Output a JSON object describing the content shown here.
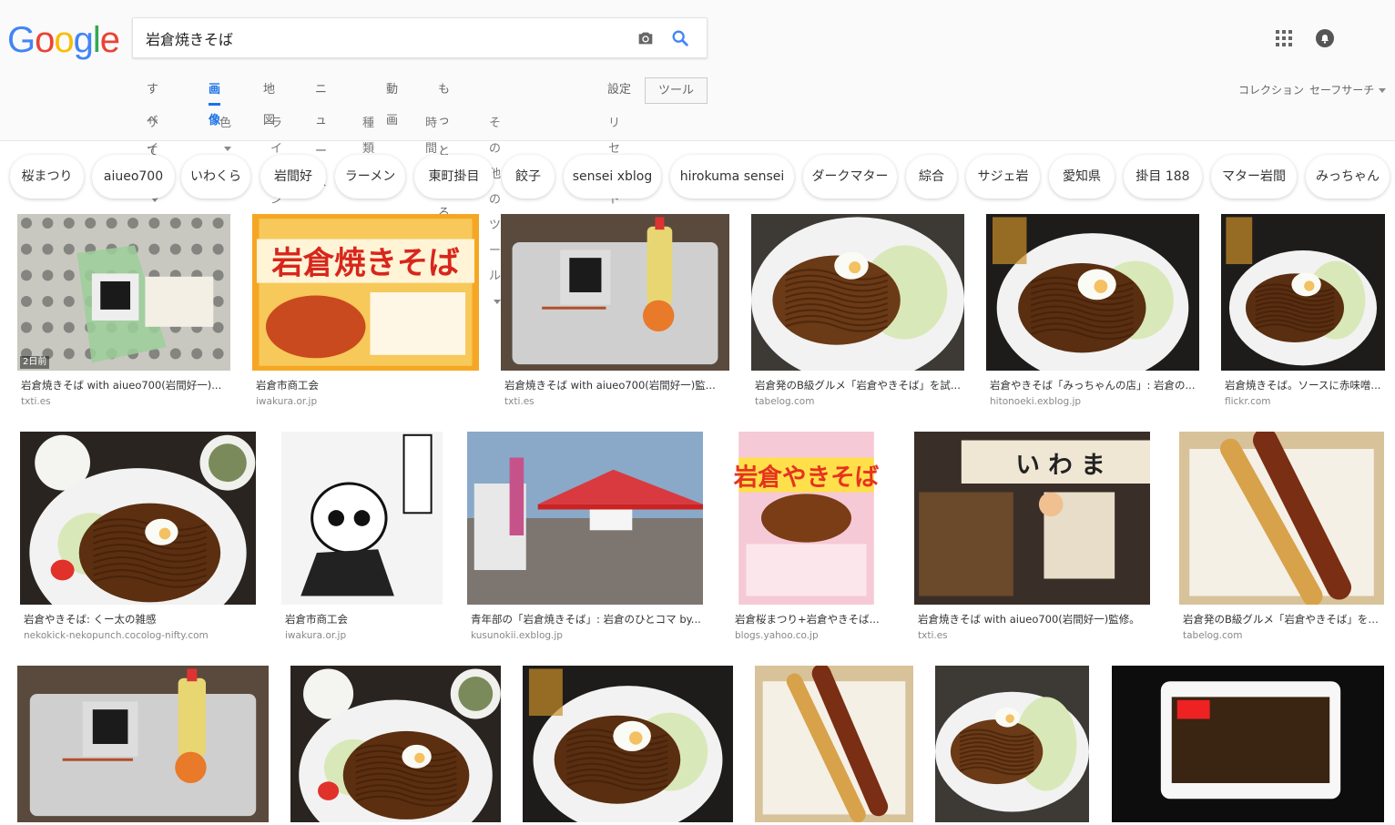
{
  "header": {
    "logo_letters": [
      "G",
      "o",
      "o",
      "g",
      "l",
      "e"
    ],
    "logo_colors": [
      "#4285f4",
      "#ea4335",
      "#fbbc05",
      "#4285f4",
      "#34a853",
      "#ea4335"
    ],
    "search_value": "岩倉焼きそば",
    "apps_icon": "apps-grid-icon",
    "notification_icon": "notifications-icon"
  },
  "tabs": [
    {
      "label": "すべて",
      "active": false
    },
    {
      "label": "画像",
      "active": true
    },
    {
      "label": "地図",
      "active": false
    },
    {
      "label": "ニュース",
      "active": false
    },
    {
      "label": "動画",
      "active": false
    },
    {
      "label": "もっと見る",
      "active": false
    }
  ],
  "settings_label": "設定",
  "tools_label": "ツール",
  "collection_label": "コレクション",
  "safesearch_label": "セーフサーチ",
  "filters": [
    {
      "label": "サイズ",
      "dropdown": true
    },
    {
      "label": "色",
      "dropdown": true
    },
    {
      "label": "ライセンス",
      "dropdown": true
    },
    {
      "label": "種類",
      "dropdown": true
    },
    {
      "label": "時間",
      "dropdown": true
    },
    {
      "label": "その他のツール",
      "dropdown": true
    },
    {
      "label": "リセット",
      "dropdown": false
    }
  ],
  "chips": [
    "桜まつり",
    "aiueo700",
    "いわくら",
    "岩間好",
    "ラーメン",
    "東町掛目",
    "餃子",
    "sensei xblog",
    "hirokuma sensei",
    "ダークマター",
    "綜合",
    "サジェ岩",
    "愛知県",
    "掛目 188",
    "マター岩間",
    "みっちゃん"
  ],
  "results": [
    {
      "caption": "岩倉焼きそば with aiueo700(岩間好一)...",
      "domain": "txti.es",
      "badge": "2日前",
      "scene": "tray"
    },
    {
      "caption": "岩倉市商工会",
      "domain": "iwakura.or.jp",
      "badge": "",
      "scene": "poster"
    },
    {
      "caption": "岩倉焼きそば with aiueo700(岩間好一)監...",
      "domain": "txti.es",
      "badge": "",
      "scene": "tray2"
    },
    {
      "caption": "岩倉発のB級グルメ「岩倉やきそば」を試...",
      "domain": "tabelog.com",
      "badge": "",
      "scene": "noodles"
    },
    {
      "caption": "岩倉やきそば「みっちゃんの店」: 岩倉の...",
      "domain": "hitonoeki.exblog.jp",
      "badge": "",
      "scene": "noodles-dark"
    },
    {
      "caption": "岩倉焼きそば。ソースに赤味噌...",
      "domain": "flickr.com",
      "badge": "",
      "scene": "noodles-dark"
    },
    {
      "caption": "岩倉やきそば: くー太の雑感",
      "domain": "nekokick-nekopunch.cocolog-nifty.com",
      "badge": "",
      "scene": "set-meal"
    },
    {
      "caption": "岩倉市商工会",
      "domain": "iwakura.or.jp",
      "badge": "",
      "scene": "mascot"
    },
    {
      "caption": "青年部の「岩倉焼きそば」: 岩倉のひとコマ by...",
      "domain": "kusunokii.exblog.jp",
      "badge": "",
      "scene": "tent"
    },
    {
      "caption": "岩倉桜まつり+岩倉やきそば...",
      "domain": "blogs.yahoo.co.jp",
      "badge": "",
      "scene": "flyer"
    },
    {
      "caption": "岩倉焼きそば with aiueo700(岩間好一)監修。",
      "domain": "txti.es",
      "badge": "",
      "scene": "shop"
    },
    {
      "caption": "岩倉発のB級グルメ「岩倉やきそば」を試...",
      "domain": "tabelog.com",
      "badge": "",
      "scene": "skewers"
    },
    {
      "caption": "",
      "domain": "",
      "badge": "",
      "scene": "tray2"
    },
    {
      "caption": "",
      "domain": "",
      "badge": "",
      "scene": "set-meal"
    },
    {
      "caption": "",
      "domain": "",
      "badge": "",
      "scene": "noodles-dark"
    },
    {
      "caption": "",
      "domain": "",
      "badge": "",
      "scene": "skewers"
    },
    {
      "caption": "",
      "domain": "",
      "badge": "",
      "scene": "noodles"
    },
    {
      "caption": "",
      "domain": "",
      "badge": "",
      "scene": "box"
    }
  ]
}
